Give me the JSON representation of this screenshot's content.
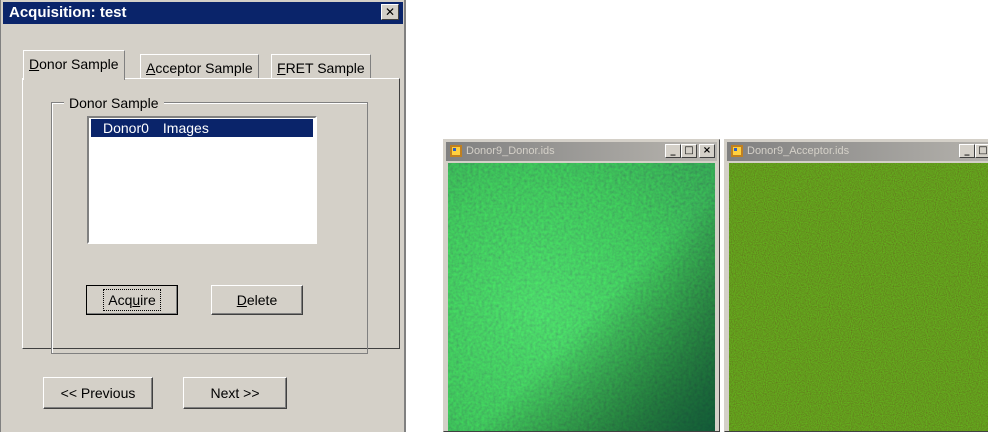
{
  "dialog": {
    "title": "Acquisition: test",
    "close_glyph": "✕",
    "tabs": [
      {
        "pre": "",
        "key": "D",
        "post": "onor Sample"
      },
      {
        "pre": "",
        "key": "A",
        "post": "cceptor Sample"
      },
      {
        "pre": "",
        "key": "F",
        "post": "RET Sample"
      }
    ],
    "group_label": "Donor Sample",
    "list_items": [
      {
        "name": "Donor0",
        "type": "Images"
      }
    ],
    "acquire": {
      "pre": "Acq",
      "key": "u",
      "post": "ire"
    },
    "delete": {
      "pre": "",
      "key": "D",
      "post": "elete"
    },
    "previous_label": "<< Previous",
    "next_label": "Next >>"
  },
  "windows": [
    {
      "title": "Donor9_Donor.ids",
      "image": "donor-fluorescence-image"
    },
    {
      "title": "Donor9_Acceptor.ids",
      "image": "acceptor-fluorescence-image"
    }
  ],
  "colors": {
    "title_active": "#0a246a",
    "face": "#d4d0c8",
    "donor_green": "#2fbf5a",
    "acceptor_olive": "#4a4a12"
  }
}
